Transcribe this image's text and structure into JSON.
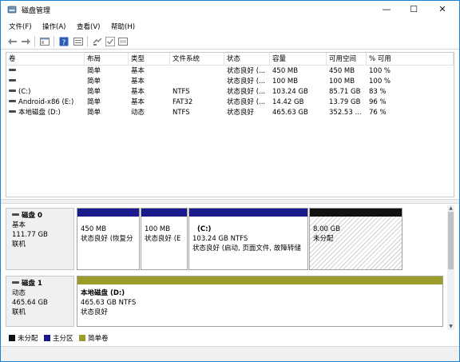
{
  "window": {
    "title": "磁盘管理",
    "min_glyph": "—",
    "max_glyph": "☐",
    "close_glyph": "✕"
  },
  "menu": [
    {
      "label": "文件(F)"
    },
    {
      "label": "操作(A)"
    },
    {
      "label": "查看(V)"
    },
    {
      "label": "帮助(H)"
    }
  ],
  "toolbar": {
    "icons": [
      "back-arrow-icon",
      "forward-arrow-icon",
      "console-tree-icon",
      "help-icon",
      "properties-icon",
      "connect-icon",
      "check-icon",
      "rescan-icon"
    ]
  },
  "table": {
    "columns": [
      "卷",
      "布局",
      "类型",
      "文件系统",
      "状态",
      "容量",
      "可用空间",
      "% 可用"
    ],
    "rows": [
      [
        "",
        "简单",
        "基本",
        "",
        "状态良好 (...",
        "450 MB",
        "450 MB",
        "100 %"
      ],
      [
        "",
        "简单",
        "基本",
        "",
        "状态良好 (...",
        "100 MB",
        "100 MB",
        "100 %"
      ],
      [
        "(C:)",
        "简单",
        "基本",
        "NTFS",
        "状态良好 (...",
        "103.24 GB",
        "85.71 GB",
        "83 %"
      ],
      [
        "Android-x86 (E:)",
        "简单",
        "基本",
        "FAT32",
        "状态良好 (...",
        "14.42 GB",
        "13.79 GB",
        "96 %"
      ],
      [
        "本地磁盘 (D:)",
        "简单",
        "动态",
        "NTFS",
        "状态良好",
        "465.63 GB",
        "352.53 ...",
        "76 %"
      ]
    ]
  },
  "disks": [
    {
      "title": "磁盘 0",
      "type": "基本",
      "size": "111.77 GB",
      "status": "联机",
      "partitions": [
        {
          "name": "",
          "size": "450 MB",
          "status": "状态良好 (恢复分",
          "bar_color": "#1a1a8c"
        },
        {
          "name": "",
          "size": "100 MB",
          "status": "状态良好 (E",
          "bar_color": "#1a1a8c"
        },
        {
          "name": "(C:)",
          "size": "103.24 GB NTFS",
          "status": "状态良好 (启动, 页面文件, 故障转储",
          "bar_color": "#1a1a8c"
        },
        {
          "name": "",
          "size": "8.00 GB",
          "status": "未分配",
          "bar_color": "#111111"
        }
      ]
    },
    {
      "title": "磁盘 1",
      "type": "动态",
      "size": "465.64 GB",
      "status": "联机",
      "partitions": [
        {
          "name": "本地磁盘 (D:)",
          "size": "465.63 GB NTFS",
          "status": "状态良好",
          "bar_color": "#9c9c2a"
        }
      ]
    }
  ],
  "legend": [
    {
      "label": "未分配",
      "color": "#111111"
    },
    {
      "label": "主分区",
      "color": "#1a1a8c"
    },
    {
      "label": "简单卷",
      "color": "#9c9c2a"
    }
  ],
  "colors": {
    "accent": "#1883d7",
    "primary_partition": "#1a1a8c",
    "unallocated": "#111111",
    "simple_volume": "#9c9c2a"
  }
}
